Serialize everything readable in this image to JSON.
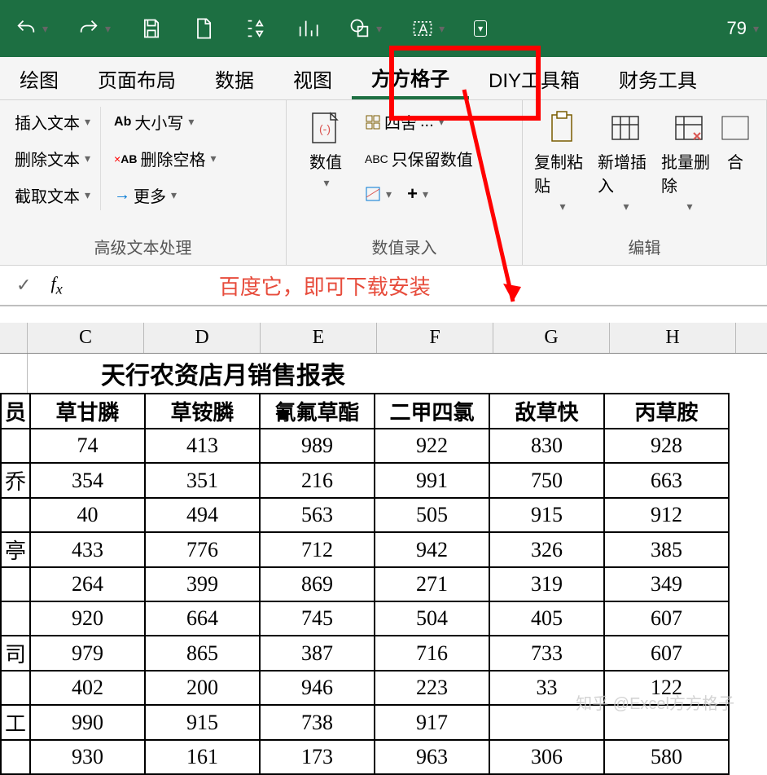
{
  "qat": {
    "zoom": "79"
  },
  "menu": {
    "items": [
      "绘图",
      "页面布局",
      "数据",
      "视图",
      "方方格子",
      "DIY工具箱",
      "财务工具"
    ],
    "activeIndex": 4
  },
  "ribbon": {
    "group1": {
      "label": "高级文本处理",
      "col1": [
        "插入文本",
        "删除文本",
        "截取文本"
      ],
      "col2_btn1": "大小写",
      "col2_btn2": "删除空格",
      "col2_btn3": "更多"
    },
    "group2": {
      "label": "数值录入",
      "big_btn": "数值",
      "btn1": "四舍",
      "btn2": "只保留数值"
    },
    "group3": {
      "label": "编辑",
      "btns": [
        "复制粘贴",
        "新增插入",
        "批量删除"
      ]
    }
  },
  "formula_bar": {
    "text": "百度它，即可下载安装"
  },
  "columns": [
    "C",
    "D",
    "E",
    "F",
    "G",
    "H"
  ],
  "sheet_title": "天行农资店月销售报表",
  "headers_partial_first": "员",
  "headers": [
    "草甘膦",
    "草铵膦",
    "氰氟草酯",
    "二甲四氯",
    "敌草快",
    "丙草胺"
  ],
  "rows": [
    {
      "partial": "",
      "vals": [
        74,
        413,
        989,
        922,
        830,
        928
      ]
    },
    {
      "partial": "乔",
      "vals": [
        354,
        351,
        216,
        991,
        750,
        663
      ]
    },
    {
      "partial": "",
      "vals": [
        40,
        494,
        563,
        505,
        915,
        912
      ]
    },
    {
      "partial": "亭",
      "vals": [
        433,
        776,
        712,
        942,
        326,
        385
      ]
    },
    {
      "partial": "",
      "vals": [
        264,
        399,
        869,
        271,
        319,
        349
      ]
    },
    {
      "partial": "",
      "vals": [
        920,
        664,
        745,
        504,
        405,
        607
      ]
    },
    {
      "partial": "司",
      "vals": [
        979,
        865,
        387,
        716,
        733,
        607
      ]
    },
    {
      "partial": "",
      "vals": [
        402,
        200,
        946,
        223,
        33,
        122
      ]
    },
    {
      "partial": "工",
      "vals": [
        990,
        915,
        738,
        917,
        "",
        ""
      ]
    },
    {
      "partial": "",
      "vals": [
        930,
        161,
        173,
        963,
        306,
        580
      ]
    }
  ],
  "watermark": "知乎 @Excel方方格子"
}
